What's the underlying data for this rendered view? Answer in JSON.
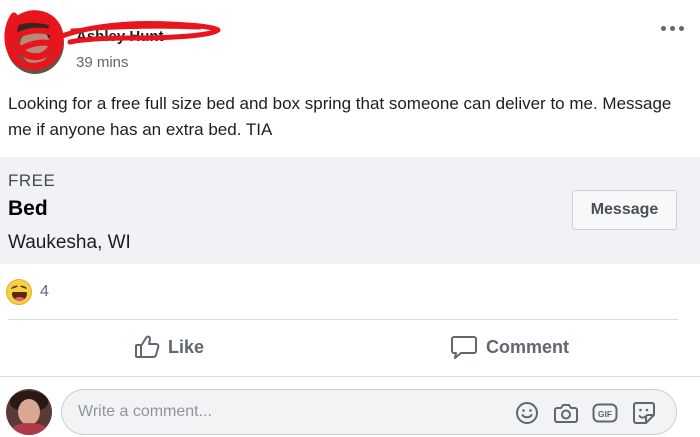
{
  "post": {
    "author": {
      "name": "Ashley Hunt",
      "avatar_icon": "profile-photo"
    },
    "timestamp": "39 mins",
    "menu_icon": "more-horizontal-icon",
    "text": "Looking for a free full size bed and box spring that someone can deliver to me. Message me if anyone has an extra bed. TIA",
    "listing": {
      "price_tag": "FREE",
      "title": "Bed",
      "location": "Waukesha, WI",
      "message_label": "Message"
    },
    "reactions": {
      "icon": "haha-emoji-icon",
      "count": "4"
    },
    "actions": {
      "like_label": "Like",
      "comment_label": "Comment"
    },
    "composer": {
      "placeholder": "Write a comment...",
      "icons": [
        "emoji-icon",
        "camera-icon",
        "gif-icon",
        "sticker-icon"
      ]
    }
  },
  "colors": {
    "text_primary": "#1c1e21",
    "text_secondary": "#606770",
    "listing_background": "#f0f2f5",
    "redaction_scribble": "#e8161c"
  }
}
